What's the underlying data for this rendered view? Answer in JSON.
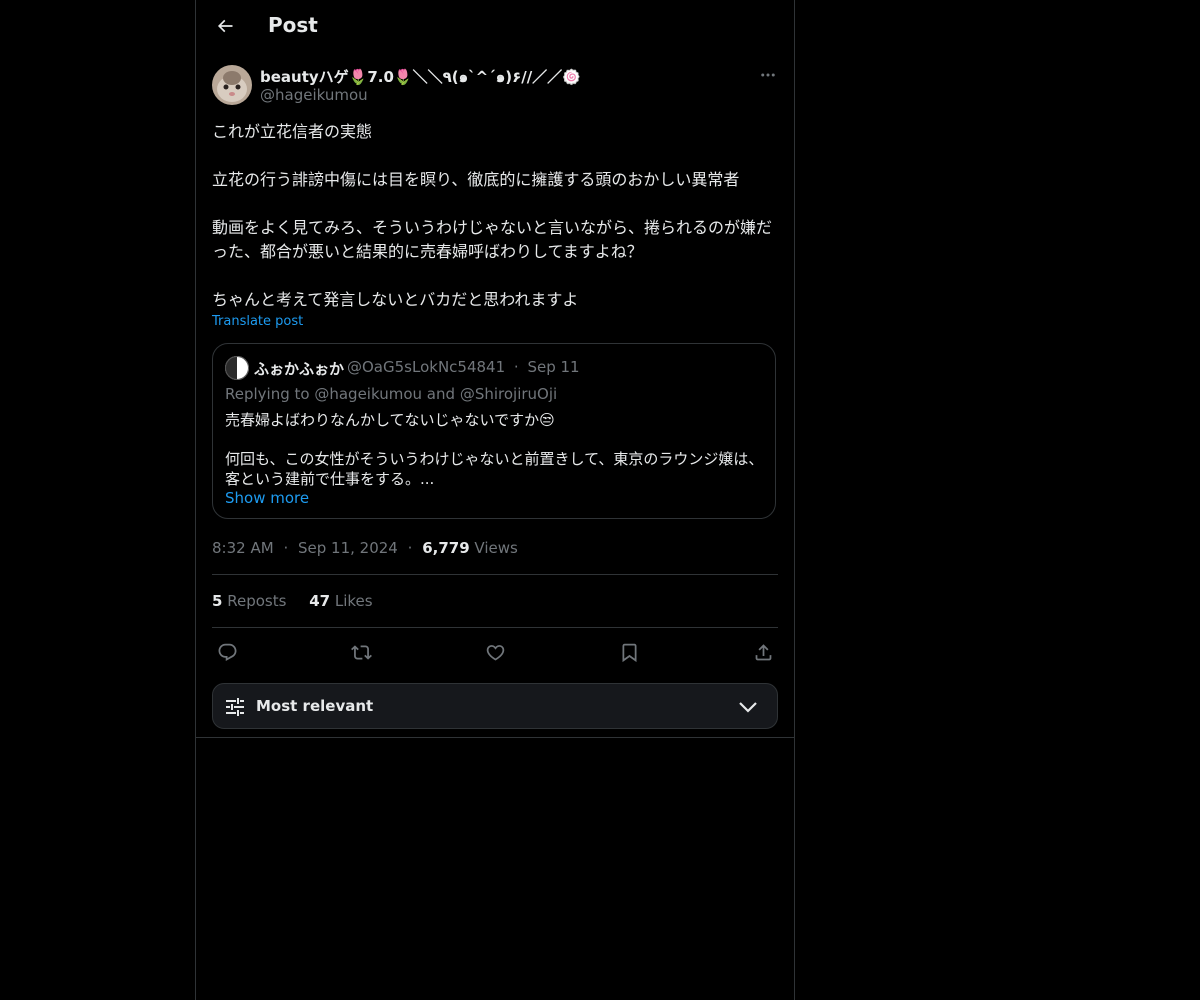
{
  "header": {
    "title": "Post"
  },
  "author": {
    "name": "beautyハゲ🌷7.0🌷＼＼٩(๑`^´๑)۶//／／🍥",
    "handle": "@hageikumou"
  },
  "post": {
    "text": "これが立花信者の実態\n\n立花の行う誹謗中傷には目を瞑り、徹底的に擁護する頭のおかしい異常者\n\n動画をよく見てみろ、そういうわけじゃないと言いながら、捲られるのが嫌だった、都合が悪いと結果的に売春婦呼ばわりしてますよね？\n\nちゃんと考えて発言しないとバカだと思われますよ",
    "translate_label": "Translate post"
  },
  "quote": {
    "name": "ふぉかふぉか",
    "handle": "@OaG5sLokNc54841",
    "separator": "·",
    "date": "Sep 11",
    "replying_prefix": "Replying to",
    "mention1": "@hageikumou",
    "and_word": "and",
    "mention2": "@ShirojiruOji",
    "text1": "売春婦よばわりなんかしてないじゃないですか😒",
    "text2": "何回も、この女性がそういうわけじゃないと前置きして、東京のラウンジ嬢は、客という建前で仕事をする。...",
    "show_more": "Show more"
  },
  "meta": {
    "time": "8:32 AM",
    "dot1": "·",
    "date": "Sep 11, 2024",
    "dot2": "·",
    "views_count": "6,779",
    "views_label": "Views"
  },
  "stats": {
    "reposts_count": "5",
    "reposts_label": "Reposts",
    "likes_count": "47",
    "likes_label": "Likes"
  },
  "sort": {
    "label": "Most relevant"
  },
  "colors": {
    "background": "#000000",
    "text": "#e7e9ea",
    "muted": "#71767b",
    "accent": "#1d9bf0",
    "border": "#2f3336"
  }
}
